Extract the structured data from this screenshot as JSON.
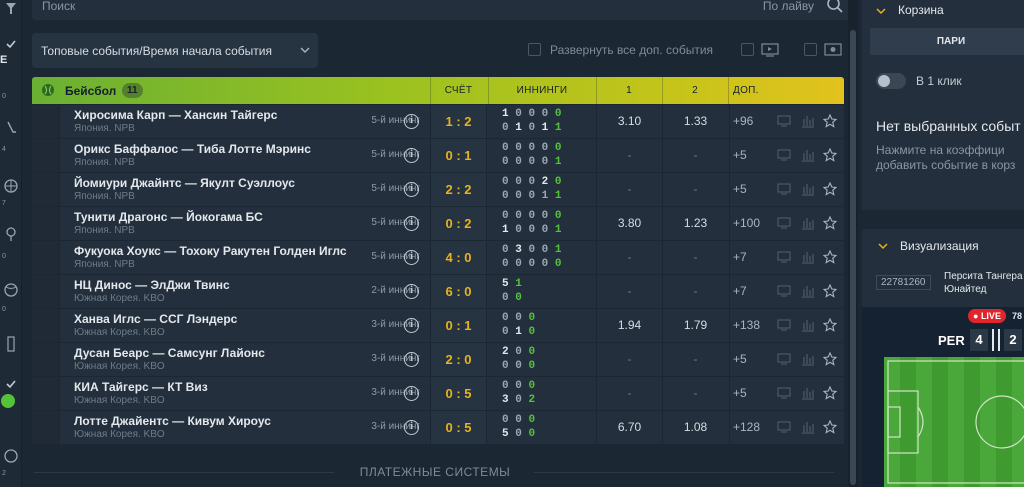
{
  "rail": {
    "subs": [
      "0",
      "4",
      "7",
      "0",
      "0",
      "2"
    ],
    "top_label": "E"
  },
  "search": {
    "placeholder": "Поиск",
    "mode_label": "По лайву"
  },
  "filter": {
    "selected": "Топовые события/Время начала события"
  },
  "expand_all_label": "Развернуть все доп. события",
  "table": {
    "sport": "Бейсбол",
    "count": "11",
    "headers": {
      "score": "СЧЁТ",
      "innings": "ИННИНГИ",
      "c1": "1",
      "c2": "2",
      "more": "ДОП."
    },
    "rows": [
      {
        "teams": "Хиросима Карп — Хансин Тайгерс",
        "league": "Япония. NPB",
        "inning": "5-й иннинг",
        "score": "1 : 2",
        "inn1": [
          [
            "w",
            "1"
          ],
          [
            "z",
            "0"
          ],
          [
            "z",
            "0"
          ],
          [
            "z",
            "0"
          ],
          [
            "g",
            "0"
          ]
        ],
        "inn2": [
          [
            "z",
            "0"
          ],
          [
            "w",
            "1"
          ],
          [
            "z",
            "0"
          ],
          [
            "w",
            "1"
          ],
          [
            "g",
            "1"
          ]
        ],
        "o1": "3.10",
        "o2": "1.33",
        "more": "+96"
      },
      {
        "teams": "Орикс Баффалос — Тиба Лотте Мэринс",
        "league": "Япония. NPB",
        "inning": "5-й иннинг",
        "score": "0 : 1",
        "inn1": [
          [
            "z",
            "0"
          ],
          [
            "z",
            "0"
          ],
          [
            "z",
            "0"
          ],
          [
            "z",
            "0"
          ],
          [
            "g",
            "0"
          ]
        ],
        "inn2": [
          [
            "z",
            "0"
          ],
          [
            "z",
            "0"
          ],
          [
            "z",
            "0"
          ],
          [
            "z",
            "0"
          ],
          [
            "g",
            "1"
          ]
        ],
        "o1": "-",
        "o2": "-",
        "more": "+5"
      },
      {
        "teams": "Йомиури Джайнтс — Якулт Суэллоус",
        "league": "Япония. NPB",
        "inning": "5-й иннинг",
        "score": "2 : 2",
        "inn1": [
          [
            "z",
            "0"
          ],
          [
            "z",
            "0"
          ],
          [
            "z",
            "0"
          ],
          [
            "w",
            "2"
          ],
          [
            "g",
            "0"
          ]
        ],
        "inn2": [
          [
            "z",
            "0"
          ],
          [
            "z",
            "0"
          ],
          [
            "z",
            "0"
          ],
          [
            "z",
            "1"
          ],
          [
            "g",
            "1"
          ]
        ],
        "o1": "-",
        "o2": "-",
        "more": "+5"
      },
      {
        "teams": "Тунити Драгонс — Йокогама БС",
        "league": "Япония. NPB",
        "inning": "5-й иннинг",
        "score": "0 : 2",
        "inn1": [
          [
            "z",
            "0"
          ],
          [
            "z",
            "0"
          ],
          [
            "z",
            "0"
          ],
          [
            "z",
            "0"
          ],
          [
            "g",
            "0"
          ]
        ],
        "inn2": [
          [
            "w",
            "1"
          ],
          [
            "z",
            "0"
          ],
          [
            "z",
            "0"
          ],
          [
            "z",
            "0"
          ],
          [
            "g",
            "1"
          ]
        ],
        "o1": "3.80",
        "o2": "1.23",
        "more": "+100"
      },
      {
        "teams": "Фукуока Хоукс — Тохоку Ракутен Голден Иглс",
        "league": "Япония. NPB",
        "inning": "5-й иннинг",
        "score": "4 : 0",
        "inn1": [
          [
            "z",
            "0"
          ],
          [
            "w",
            "3"
          ],
          [
            "z",
            "0"
          ],
          [
            "z",
            "0"
          ],
          [
            "g",
            "1"
          ]
        ],
        "inn2": [
          [
            "z",
            "0"
          ],
          [
            "z",
            "0"
          ],
          [
            "z",
            "0"
          ],
          [
            "z",
            "0"
          ],
          [
            "g",
            "0"
          ]
        ],
        "o1": "-",
        "o2": "-",
        "more": "+7"
      },
      {
        "teams": "НЦ Динос — ЭлДжи Твинс",
        "league": "Южная Корея. KBO",
        "inning": "2-й иннинг",
        "score": "6 : 0",
        "inn1": [
          [
            "w",
            "5"
          ],
          [
            "g",
            "1"
          ]
        ],
        "inn2": [
          [
            "z",
            "0"
          ],
          [
            "g",
            "0"
          ]
        ],
        "o1": "-",
        "o2": "-",
        "more": "+7"
      },
      {
        "teams": "Ханва Иглс — ССГ Лэндерс",
        "league": "Южная Корея. KBO",
        "inning": "3-й иннинг",
        "score": "0 : 1",
        "inn1": [
          [
            "z",
            "0"
          ],
          [
            "z",
            "0"
          ],
          [
            "g",
            "0"
          ]
        ],
        "inn2": [
          [
            "z",
            "0"
          ],
          [
            "w",
            "1"
          ],
          [
            "g",
            "0"
          ]
        ],
        "o1": "1.94",
        "o2": "1.79",
        "more": "+138"
      },
      {
        "teams": "Дусан Беарс — Самсунг Лайонс",
        "league": "Южная Корея. KBO",
        "inning": "3-й иннинг",
        "score": "2 : 0",
        "inn1": [
          [
            "w",
            "2"
          ],
          [
            "z",
            "0"
          ],
          [
            "g",
            "0"
          ]
        ],
        "inn2": [
          [
            "z",
            "0"
          ],
          [
            "z",
            "0"
          ],
          [
            "g",
            "0"
          ]
        ],
        "o1": "-",
        "o2": "-",
        "more": "+5"
      },
      {
        "teams": "КИА Тайгерс — КТ Виз",
        "league": "Южная Корея. KBO",
        "inning": "3-й иннинг",
        "score": "0 : 5",
        "inn1": [
          [
            "z",
            "0"
          ],
          [
            "z",
            "0"
          ],
          [
            "g",
            "0"
          ]
        ],
        "inn2": [
          [
            "w",
            "3"
          ],
          [
            "z",
            "0"
          ],
          [
            "g",
            "2"
          ]
        ],
        "o1": "-",
        "o2": "-",
        "more": "+5"
      },
      {
        "teams": "Лотте Джайентс — Кивум Хироус",
        "league": "Южная Корея. KBO",
        "inning": "3-й иннинг",
        "score": "0 : 5",
        "inn1": [
          [
            "z",
            "0"
          ],
          [
            "z",
            "0"
          ],
          [
            "g",
            "0"
          ]
        ],
        "inn2": [
          [
            "w",
            "5"
          ],
          [
            "z",
            "0"
          ],
          [
            "g",
            "0"
          ]
        ],
        "o1": "6.70",
        "o2": "1.08",
        "more": "+128"
      }
    ]
  },
  "footer": {
    "label": "ПЛАТЕЖНЫЕ СИСТЕМЫ"
  },
  "betslip": {
    "title": "Корзина",
    "tab": "ПАРИ",
    "one_click": "В 1 клик",
    "empty_title": "Нет выбранных событ",
    "hint_line1": "Нажмите на коэффици",
    "hint_line2": "добавить событие в корз"
  },
  "viz": {
    "title": "Визуализация",
    "match_id": "22781260",
    "match_line1": "Персита Тангера",
    "match_line2": "Юнайтед",
    "live": "LIVE",
    "minute": "78",
    "team": "PER",
    "score1": "4",
    "score2": "2"
  },
  "colors": {
    "accent_yellow": "#e8b21e",
    "green": "#55c23b",
    "live_red": "#e1252d"
  }
}
